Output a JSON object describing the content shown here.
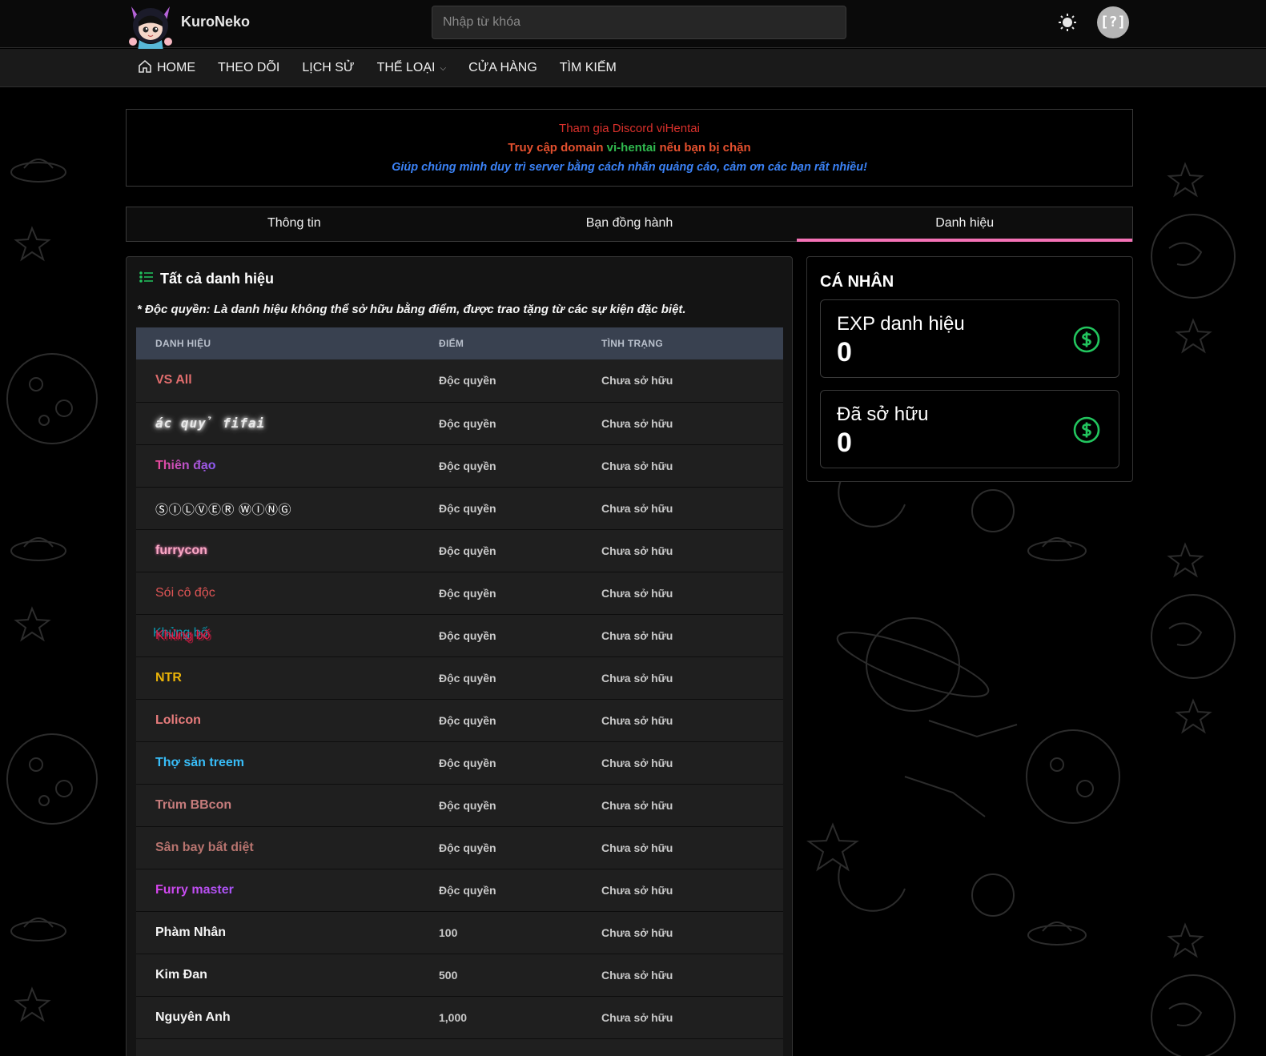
{
  "header": {
    "brand": "KuroNeko",
    "search_placeholder": "Nhập từ khóa",
    "avatar_text": "[?]"
  },
  "nav": {
    "items": [
      {
        "label": "HOME",
        "icon": "home-icon"
      },
      {
        "label": "THEO DÕI"
      },
      {
        "label": "LỊCH SỬ"
      },
      {
        "label": "THỂ LOẠI",
        "dropdown": true
      },
      {
        "label": "CỬA HÀNG"
      },
      {
        "label": "TÌM KIẾM"
      }
    ]
  },
  "notice": {
    "line1": "Tham gia Discord viHentai",
    "line2_a": "Truy cập domain ",
    "line2_b": "vi-hentai",
    "line2_c": " nếu bạn bị chặn",
    "line3": "Giúp chúng mình duy trì server bằng cách nhấn quảng cáo, cảm ơn các bạn rất nhiều!"
  },
  "tabs": [
    {
      "label": "Thông tin",
      "active": false
    },
    {
      "label": "Bạn đồng hành",
      "active": false
    },
    {
      "label": "Danh hiệu",
      "active": true
    }
  ],
  "titles_card": {
    "heading": "Tất cả danh hiệu",
    "note": "* Độc quyền: Là danh hiệu không thể sở hữu bằng điểm, được trao tặng từ các sự kiện đặc biệt.",
    "columns": [
      "DANH HIỆU",
      "ĐIỂM",
      "TÌNH TRẠNG"
    ],
    "rows": [
      {
        "name": "VS All",
        "points": "Độc quyền",
        "status": "Chưa sở hữu"
      },
      {
        "name": "ác quỷ fifai",
        "points": "Độc quyền",
        "status": "Chưa sở hữu"
      },
      {
        "name": "Thiên đạo",
        "points": "Độc quyền",
        "status": "Chưa sở hữu"
      },
      {
        "name": "ⓈⒾⓁⓋⒺⓇ ⓌⒾⓃⒼ",
        "points": "Độc quyền",
        "status": "Chưa sở hữu"
      },
      {
        "name": "furrycon",
        "points": "Độc quyền",
        "status": "Chưa sở hữu"
      },
      {
        "name": "Sói cô độc",
        "points": "Độc quyền",
        "status": "Chưa sở hữu"
      },
      {
        "name": "Khủng bố",
        "points": "Độc quyền",
        "status": "Chưa sở hữu"
      },
      {
        "name": "NTR",
        "points": "Độc quyền",
        "status": "Chưa sở hữu"
      },
      {
        "name": "Lolicon",
        "points": "Độc quyền",
        "status": "Chưa sở hữu"
      },
      {
        "name": "Thợ săn treem",
        "points": "Độc quyền",
        "status": "Chưa sở hữu"
      },
      {
        "name": "Trùm BBcon",
        "points": "Độc quyền",
        "status": "Chưa sở hữu"
      },
      {
        "name": "Sân bay bất diệt",
        "points": "Độc quyền",
        "status": "Chưa sở hữu"
      },
      {
        "name": "Furry master",
        "points": "Độc quyền",
        "status": "Chưa sở hữu"
      },
      {
        "name": "Phàm Nhân",
        "points": "100",
        "status": "Chưa sở hữu"
      },
      {
        "name": "Kim Đan",
        "points": "500",
        "status": "Chưa sở hữu"
      },
      {
        "name": "Nguyên Anh",
        "points": "1,000",
        "status": "Chưa sở hữu"
      }
    ]
  },
  "personal": {
    "heading": "CÁ NHÂN",
    "exp_label": "EXP danh hiệu",
    "exp_value": "0",
    "owned_label": "Đã sở hữu",
    "owned_value": "0"
  },
  "colors": {
    "tab_active": "#f472b6",
    "coin": "#22c55e",
    "table_header": "#394150"
  }
}
